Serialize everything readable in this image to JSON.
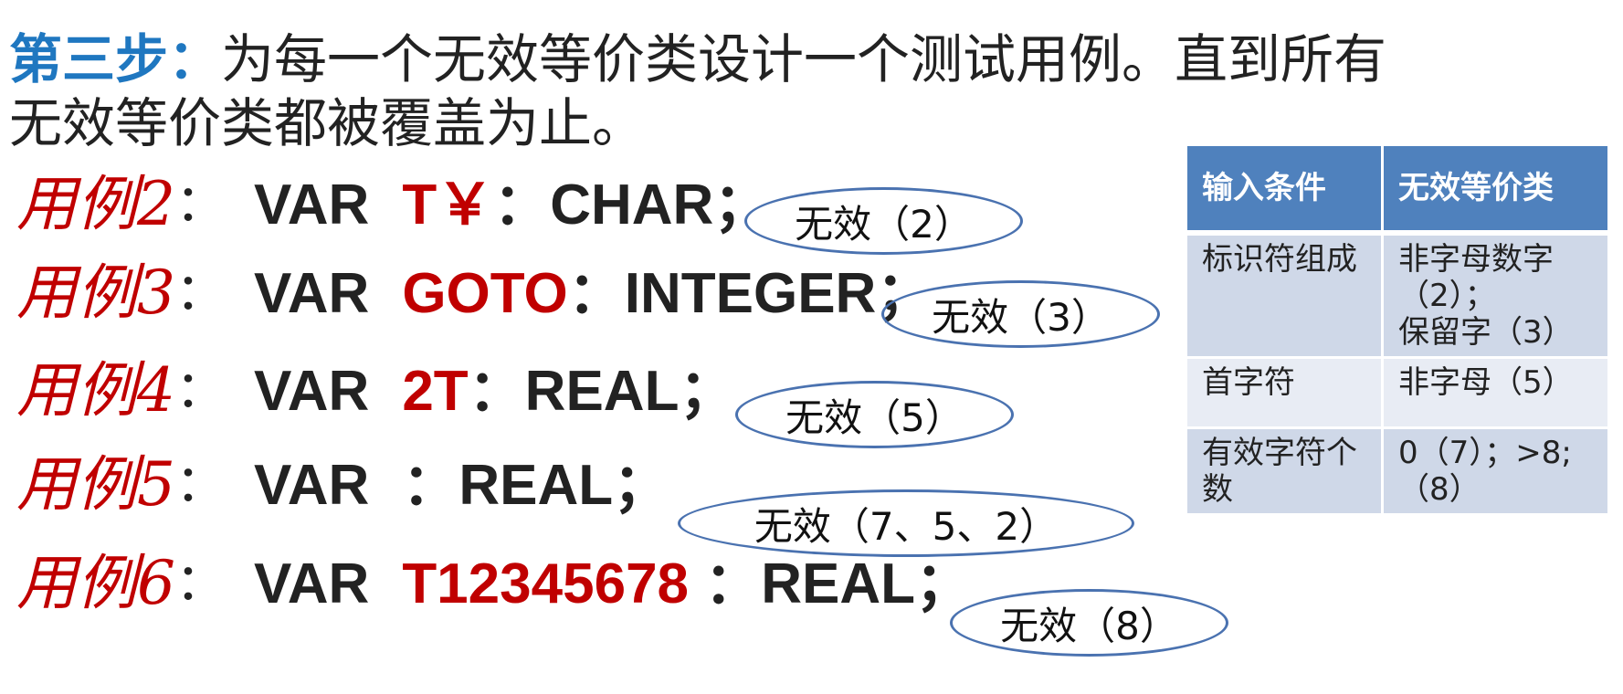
{
  "heading": {
    "step_label": "第三步：",
    "line1": "为每一个无效等价类设计一个测试用例。直到所有",
    "line2": "无效等价类都被覆盖为止。"
  },
  "cases": [
    {
      "label": "用例2",
      "colon": "：",
      "keyword": "VAR",
      "identifier": "T￥",
      "rest": "：CHAR；",
      "note": "无效（2）"
    },
    {
      "label": "用例3",
      "colon": "：",
      "keyword": "VAR",
      "identifier": "GOTO",
      "rest": "：INTEGER；",
      "note": "无效（3）"
    },
    {
      "label": "用例4",
      "colon": "：",
      "keyword": "VAR",
      "identifier": "2T",
      "rest": "：REAL；",
      "note": "无效（5）"
    },
    {
      "label": "用例5",
      "colon": "：",
      "keyword": "VAR",
      "identifier": "",
      "rest": "：REAL；",
      "note": "无效（7、5、2）"
    },
    {
      "label": "用例6",
      "colon": "：",
      "keyword": "VAR",
      "identifier": "T12345678",
      "rest": " ：REAL；",
      "note": "无效（8）"
    }
  ],
  "table": {
    "headers": [
      "输入条件",
      "无效等价类"
    ],
    "rows": [
      {
        "condition": "标识符组成",
        "classes": [
          "非字母数字",
          "（2）；",
          "保留字（3）"
        ]
      },
      {
        "condition": "首字符",
        "classes": [
          "非字母（5）"
        ]
      },
      {
        "condition": "有效字符个数",
        "classes": [
          "0（7）；>8;",
          "（8）"
        ]
      }
    ]
  },
  "colors": {
    "step_blue": "#1f77c0",
    "case_red": "#c00000",
    "oval_border": "#4a72b0",
    "table_header": "#4f81bd",
    "table_row_dark": "#cfd8e8",
    "table_row_light": "#e8ecf4"
  }
}
